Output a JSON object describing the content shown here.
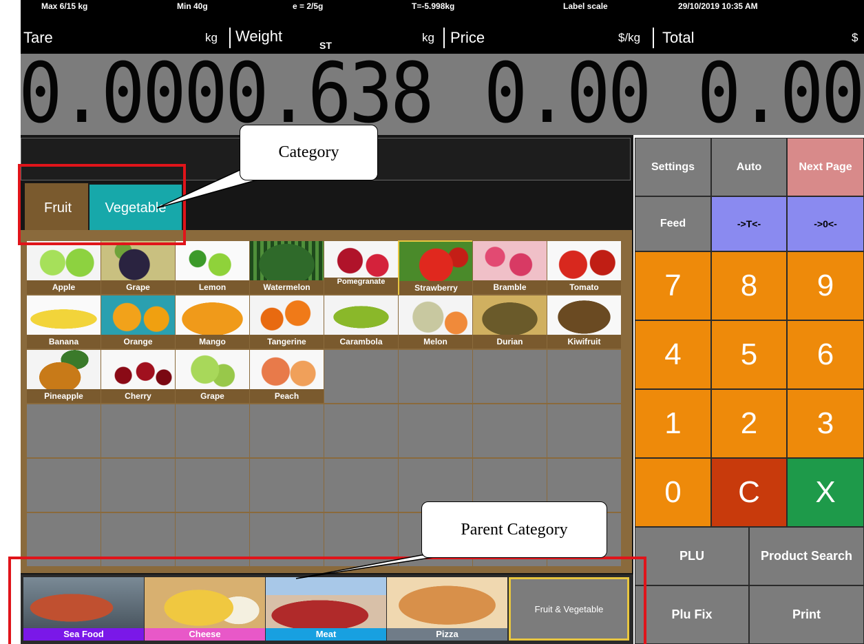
{
  "status": {
    "max": "Max 6/15 kg",
    "min": "Min 40g",
    "e": "e = 2/5g",
    "tare_info": "T=-5.998kg",
    "mode": "Label scale",
    "datetime": "29/10/2019 10:35 AM"
  },
  "readout": {
    "tare_label": "Tare",
    "tare_unit": "kg",
    "tare_value": "0.000",
    "weight_label": "Weight",
    "weight_unit": "kg",
    "weight_flag": "ST",
    "weight_value": "0.638",
    "price_label": "Price",
    "price_unit": "$/kg",
    "price_value": "0.00",
    "total_label": "Total",
    "total_unit": "$",
    "total_value": "0.00"
  },
  "tabs": [
    "Fruit",
    "Vegetable"
  ],
  "products": [
    "Apple",
    "Grape",
    "Lemon",
    "Watermelon",
    "Pomegranate",
    "Strawberry",
    "Bramble",
    "Tomato",
    "Banana",
    "Orange",
    "Mango",
    "Tangerine",
    "Carambola",
    "Melon",
    "Durian",
    "Kiwifruit",
    "Pineapple",
    "Cherry",
    "Grape",
    "Peach"
  ],
  "parent_categories": [
    "Sea Food",
    "Cheese",
    "Meat",
    "Pizza",
    "Fruit & Vegetable"
  ],
  "keys": {
    "settings": "Settings",
    "auto": "Auto",
    "next_page": "Next Page",
    "feed": "Feed",
    "tare_key": "->T<-",
    "zero_key": "->0<-",
    "n7": "7",
    "n8": "8",
    "n9": "9",
    "n4": "4",
    "n5": "5",
    "n6": "6",
    "n1": "1",
    "n2": "2",
    "n3": "3",
    "n0": "0",
    "clear": "C",
    "cancel": "X",
    "plu": "PLU",
    "product_search": "Product Search",
    "plu_fix": "Plu Fix",
    "print": "Print"
  },
  "annotations": {
    "category": "Category",
    "parent_category": "Parent Category"
  },
  "colors": {
    "accent_orange": "#ee8a0a",
    "clear_red": "#c83a0c",
    "cancel_green": "#1e9a4a",
    "tab_teal": "#17a8aa",
    "tab_brown": "#7a5a2e",
    "next_page_pink": "#d88a8a",
    "arrow_key_purple": "#8a8af0"
  }
}
